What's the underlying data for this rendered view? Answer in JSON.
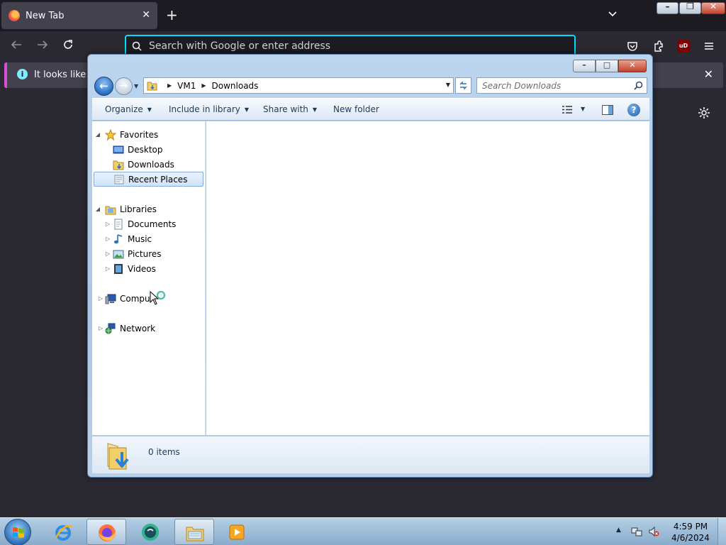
{
  "browser": {
    "tab_title": "New Tab",
    "close_tab": "✕",
    "new_tab": "+",
    "url_placeholder": "Search with Google or enter address",
    "notification": "It looks like you",
    "notification_close": "✕",
    "ublock_badge": "uD",
    "window_buttons": {
      "minimize": "–",
      "restore": "❐",
      "close": "✕"
    }
  },
  "explorer": {
    "breadcrumb": [
      "VM1",
      "Downloads"
    ],
    "search_placeholder": "Search Downloads",
    "toolbar": {
      "organize": "Organize",
      "include_in_library": "Include in library",
      "share_with": "Share with",
      "new_folder": "New folder",
      "help": "?"
    },
    "window_buttons": {
      "minimize": "–",
      "maximize": "□",
      "close": "✕"
    },
    "nav": {
      "favorites": "Favorites",
      "desktop": "Desktop",
      "downloads": "Downloads",
      "recent_places": "Recent Places",
      "libraries": "Libraries",
      "documents": "Documents",
      "music": "Music",
      "pictures": "Pictures",
      "videos": "Videos",
      "computer": "Compu",
      "network": "Network"
    },
    "status": "0 items"
  },
  "taskbar": {
    "time": "4:59 PM",
    "date": "4/6/2024"
  },
  "colors": {
    "accent": "#00ddff",
    "notification_border": "#d94fd4",
    "selection": "#cfe3fa"
  }
}
